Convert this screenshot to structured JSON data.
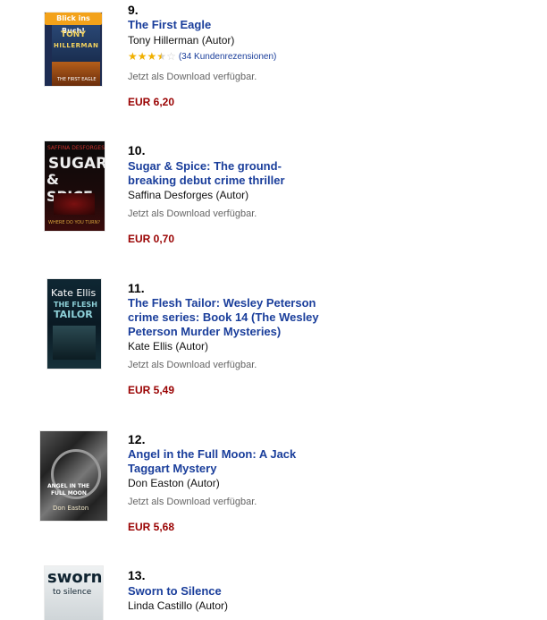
{
  "items": [
    {
      "rank": "9.",
      "title": "The First Eagle",
      "author": "Tony Hillerman (Autor)",
      "rating_stars": 3.5,
      "review_text": "(34 Kundenrezensionen)",
      "availability": "Jetzt als Download verfügbar.",
      "price": "EUR 6,20",
      "cover": {
        "badge": "Blick ins Buch!",
        "line1": "TONY",
        "line2": "HILLERMAN",
        "line3": "THE FIRST EAGLE"
      }
    },
    {
      "rank": "10.",
      "title": "Sugar & Spice: The ground-breaking debut crime thriller",
      "author": "Saffina Desforges (Autor)",
      "availability": "Jetzt als Download verfügbar.",
      "price": "EUR 0,70",
      "cover": {
        "line1": "SAFFINA DESFORGES",
        "line2": "SUGAR",
        "line3": "& SPICE",
        "line4": "WHERE DO YOU TURN?"
      }
    },
    {
      "rank": "11.",
      "title": "The Flesh Tailor: Wesley Peterson crime series: Book 14 (The Wesley Peterson Murder Mysteries)",
      "author": "Kate Ellis (Autor)",
      "availability": "Jetzt als Download verfügbar.",
      "price": "EUR 5,49",
      "cover": {
        "line1": "Kate Ellis",
        "line2": "THE FLESH",
        "line3": "TAILOR"
      }
    },
    {
      "rank": "12.",
      "title": "Angel in the Full Moon: A Jack Taggart Mystery",
      "author": "Don Easton (Autor)",
      "availability": "Jetzt als Download verfügbar.",
      "price": "EUR 5,68",
      "cover": {
        "line1": "ANGEL IN THE",
        "line2": "FULL MOON",
        "line3": "Don Easton"
      }
    },
    {
      "rank": "13.",
      "title": "Sworn to Silence",
      "author": "Linda Castillo (Autor)",
      "cover": {
        "line1": "sworn",
        "line2": "to silence"
      }
    }
  ]
}
